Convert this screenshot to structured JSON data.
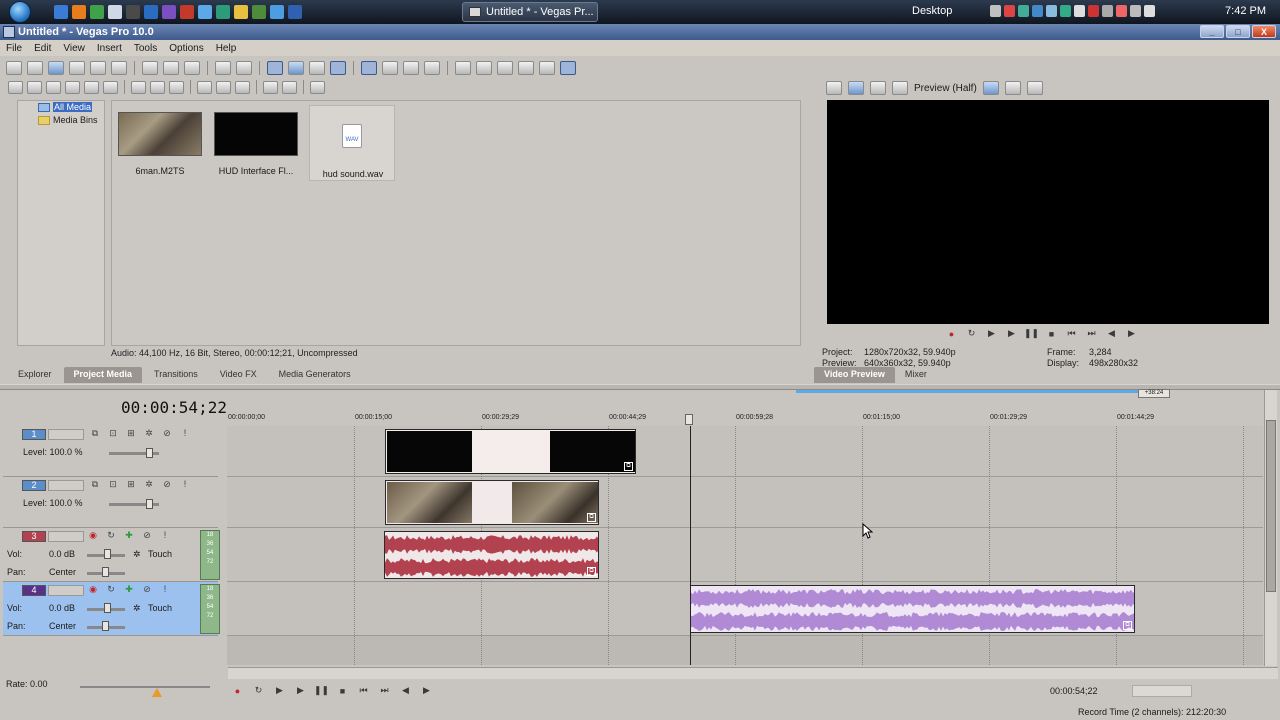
{
  "taskbar": {
    "task_button_label": "Untitled * - Vegas Pr...",
    "desktop_label": "Desktop",
    "clock": "7:42 PM"
  },
  "window": {
    "title": "Untitled * - Vegas Pro 10.0",
    "minimize": "_",
    "maximize": "□",
    "close": "X"
  },
  "menu": {
    "file": "File",
    "edit": "Edit",
    "view": "View",
    "insert": "Insert",
    "tools": "Tools",
    "options": "Options",
    "help": "Help"
  },
  "media_tree": {
    "items": [
      {
        "label": "All Media"
      },
      {
        "label": "Media Bins"
      }
    ]
  },
  "media": {
    "clips": [
      {
        "label": "6man.M2TS"
      },
      {
        "label": "HUD Interface Fl..."
      },
      {
        "label": "hud sound.wav",
        "icon_text": "WAV"
      }
    ],
    "audio_info": "Audio: 44,100 Hz, 16 Bit, Stereo, 00:00:12;21, Uncompressed"
  },
  "left_tabs": {
    "explorer": "Explorer",
    "project_media": "Project Media",
    "transitions": "Transitions",
    "video_fx": "Video FX",
    "media_generators": "Media Generators"
  },
  "preview": {
    "mode_label": "Preview (Half)",
    "project_label": "Project:",
    "project_value": "1280x720x32, 59.940p",
    "preview_label": "Preview:",
    "preview_value": "640x360x32, 59.940p",
    "frame_label": "Frame:",
    "frame_value": "3,284",
    "display_label": "Display:",
    "display_value": "498x280x32"
  },
  "right_tabs": {
    "video_preview": "Video Preview",
    "mixer": "Mixer"
  },
  "timeline": {
    "timecode": "00:00:54;22",
    "loop_end_label": "+38:24",
    "ruler": [
      "00:00:00;00",
      "00:00:15;00",
      "00:00:29;29",
      "00:00:44;29",
      "00:00:59;28",
      "00:01:15;00",
      "00:01:29;29",
      "00:01:44;29"
    ],
    "tracks": [
      {
        "number": "1",
        "level_label": "Level: 100.0 %"
      },
      {
        "number": "2",
        "level_label": "Level: 100.0 %"
      },
      {
        "number": "3",
        "vol_label": "Vol:",
        "vol_value": "0.0 dB",
        "pan_label": "Pan:",
        "pan_value": "Center",
        "mode": "Touch",
        "meter": [
          "18",
          "36",
          "54",
          "72"
        ]
      },
      {
        "number": "4",
        "vol_label": "Vol:",
        "vol_value": "0.0 dB",
        "pan_label": "Pan:",
        "pan_value": "Center",
        "mode": "Touch",
        "meter": [
          "18",
          "36",
          "54",
          "72"
        ]
      }
    ]
  },
  "transport": {
    "rate_label": "Rate: 0.00",
    "timecode_small": "00:00:54;22",
    "record_time": "Record Time (2 channels): 212:20:30"
  },
  "colors": {
    "audio_clip_track3": "#b2424f",
    "audio_clip_track4": "#b18ad6",
    "track_selected_bg": "#9dc1ee",
    "preview_bg": "#000000",
    "titlebar": "#3d5a8c"
  }
}
